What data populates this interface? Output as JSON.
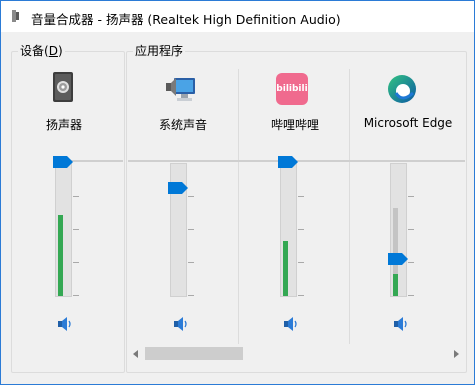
{
  "window": {
    "title": "音量合成器 - 扬声器 (Realtek High Definition Audio)",
    "accent": "#0078d7"
  },
  "device_section": {
    "label": "设备(D)",
    "label_plain": "设备(",
    "label_access_key": "D",
    "label_close": ")",
    "device": {
      "name": "扬声器",
      "icon": "speaker-device-icon",
      "volume_level": 1.0,
      "peak_level": 0.61
    }
  },
  "apps_section": {
    "label": "应用程序",
    "apps": [
      {
        "name": "系统声音",
        "icon": "system-sounds-icon",
        "volume_level": 0.79,
        "peak_level": 0.0
      },
      {
        "name": "哔哩哔哩",
        "icon": "bilibili-icon",
        "icon_text": "bilibili",
        "volume_level": 1.0,
        "peak_level": 0.42
      },
      {
        "name": "Microsoft Edge",
        "icon": "edge-icon",
        "volume_level": 0.22,
        "peak_level": 0.17
      }
    ]
  },
  "mute_icon": "speaker-volume-icon",
  "scrollbar": {
    "left_arrow": "‹",
    "right_arrow": "›"
  }
}
